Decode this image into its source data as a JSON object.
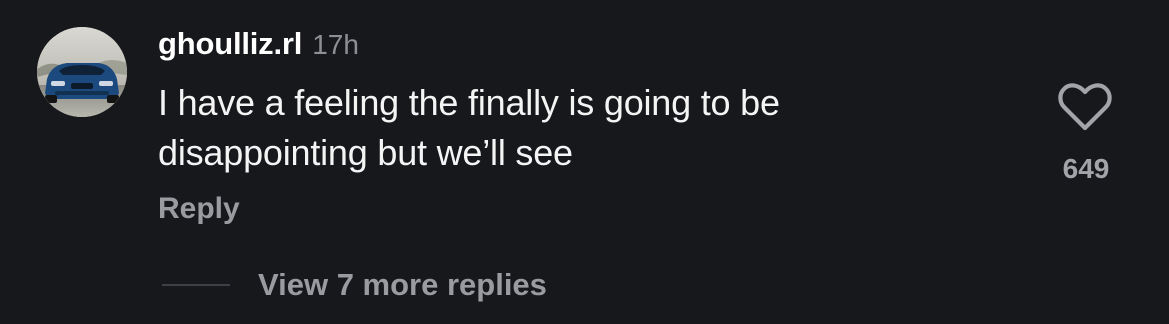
{
  "comment": {
    "username": "ghoulliz.rl",
    "time": "17h",
    "text": "I have a feeling the finally is going to be disappointing but we’ll see",
    "reply_label": "Reply",
    "like_count": "649",
    "view_replies_label": "View 7 more replies"
  },
  "icons": {
    "like": "heart-outline-icon",
    "avatar": "car-photo-avatar"
  },
  "colors": {
    "background": "#17181c",
    "primary_text": "#ffffff",
    "secondary_text": "#9a9ba1",
    "timestamp": "#8e8f95"
  }
}
